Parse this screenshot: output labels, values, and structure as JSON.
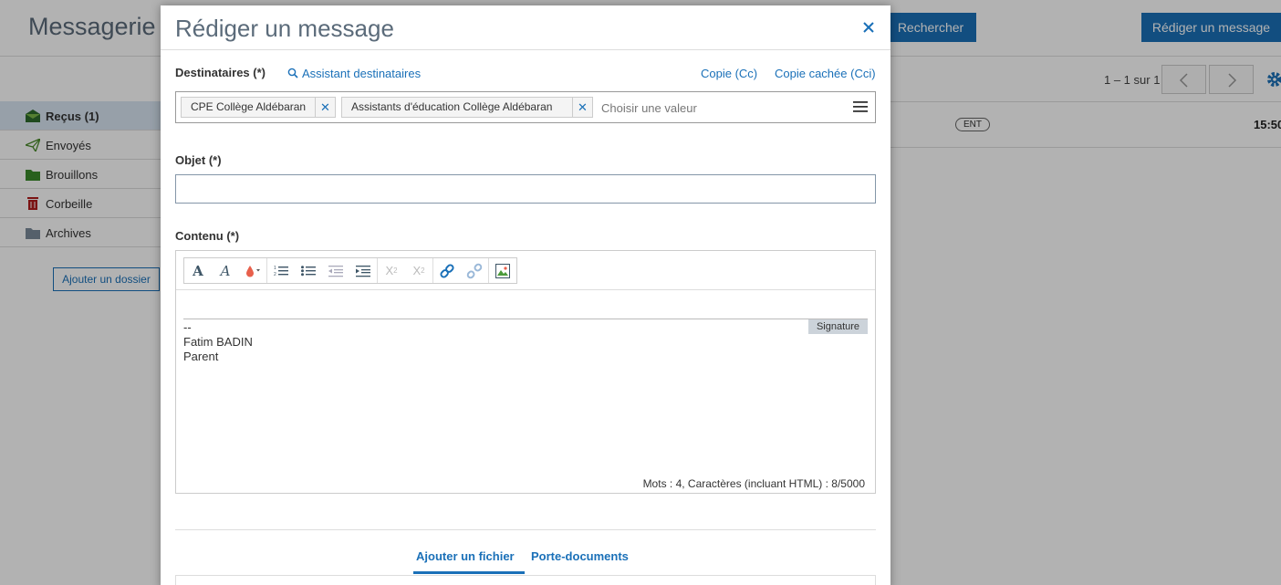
{
  "background": {
    "title": "Messagerie",
    "search_button": "Rechercher",
    "compose_button": "Rédiger un message",
    "pager": "1 – 1 sur 1",
    "sidebar": [
      {
        "label": "Reçus (1)",
        "icon": "inbox-icon",
        "active": true
      },
      {
        "label": "Envoyés",
        "icon": "paper-plane-icon",
        "active": false
      },
      {
        "label": "Brouillons",
        "icon": "folder-icon",
        "active": false
      },
      {
        "label": "Corbeille",
        "icon": "trash-icon",
        "active": false
      },
      {
        "label": "Archives",
        "icon": "folder-icon",
        "active": false
      }
    ],
    "add_folder": "Ajouter un dossier",
    "message_row": {
      "badge": "ENT",
      "time": "15:50"
    }
  },
  "modal": {
    "title": "Rédiger un message",
    "recipients_label": "Destinataires (*)",
    "assistant_link": "Assistant destinataires",
    "cc_link": "Copie (Cc)",
    "bcc_link": "Copie cachée (Cci)",
    "recipients": [
      "CPE Collège Aldébaran",
      "Assistants d'éducation Collège Aldébaran"
    ],
    "recipients_placeholder": "Choisir une valeur",
    "subject_label": "Objet (*)",
    "subject_value": "",
    "content_label": "Contenu (*)",
    "signature_badge": "Signature",
    "signature_lines": [
      "--",
      "Fatim BADIN",
      "Parent"
    ],
    "counter": "Mots : 4, Caractères (incluant HTML) : 8/5000",
    "tabs": [
      "Ajouter un fichier",
      "Porte-documents"
    ]
  },
  "colors": {
    "accent": "#1a70b8",
    "title": "#5b6b7a"
  }
}
